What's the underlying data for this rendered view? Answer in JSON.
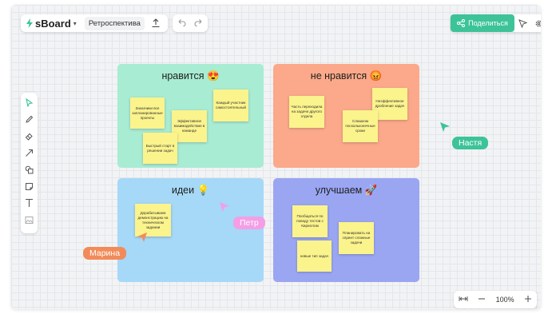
{
  "app": {
    "logo": "sBoard",
    "board_name": "Ретроспектива"
  },
  "share": {
    "label": "Поделиться"
  },
  "zoom": {
    "level": "100%"
  },
  "help": {
    "label": "?"
  },
  "quadrants": [
    {
      "title": "нравится 😍",
      "color": "#a8ecd3",
      "stickies": [
        "Заказчики все запланированные проекты",
        "Каждый участник самостоятельный",
        "Эффективное взаимодействие в команде",
        "Быстрый старт в решении задач"
      ]
    },
    {
      "title": "не нравится 😡",
      "color": "#fba98a",
      "stickies": [
        "Часть переходила на задачи другого отдела",
        "Неэффективное дробление задач",
        "Слишком поскольконечные сроки"
      ]
    },
    {
      "title": "идеи 💡",
      "color": "#a6d8f7",
      "stickies": [
        "Дорабатываем демонстрацию на техническом задании"
      ]
    },
    {
      "title": "улучшаем 🚀",
      "color": "#9aa6f2",
      "stickies": [
        "Пообщаться по поводу тестов с Кириллом",
        "Планировать на спринт сложные задачи",
        "новые тип задач"
      ]
    }
  ],
  "collaborators": [
    {
      "name": "Настя",
      "color": "#3dc398"
    },
    {
      "name": "Петр",
      "color": "#f49ee6"
    },
    {
      "name": "Марина",
      "color": "#f28b5a"
    }
  ]
}
